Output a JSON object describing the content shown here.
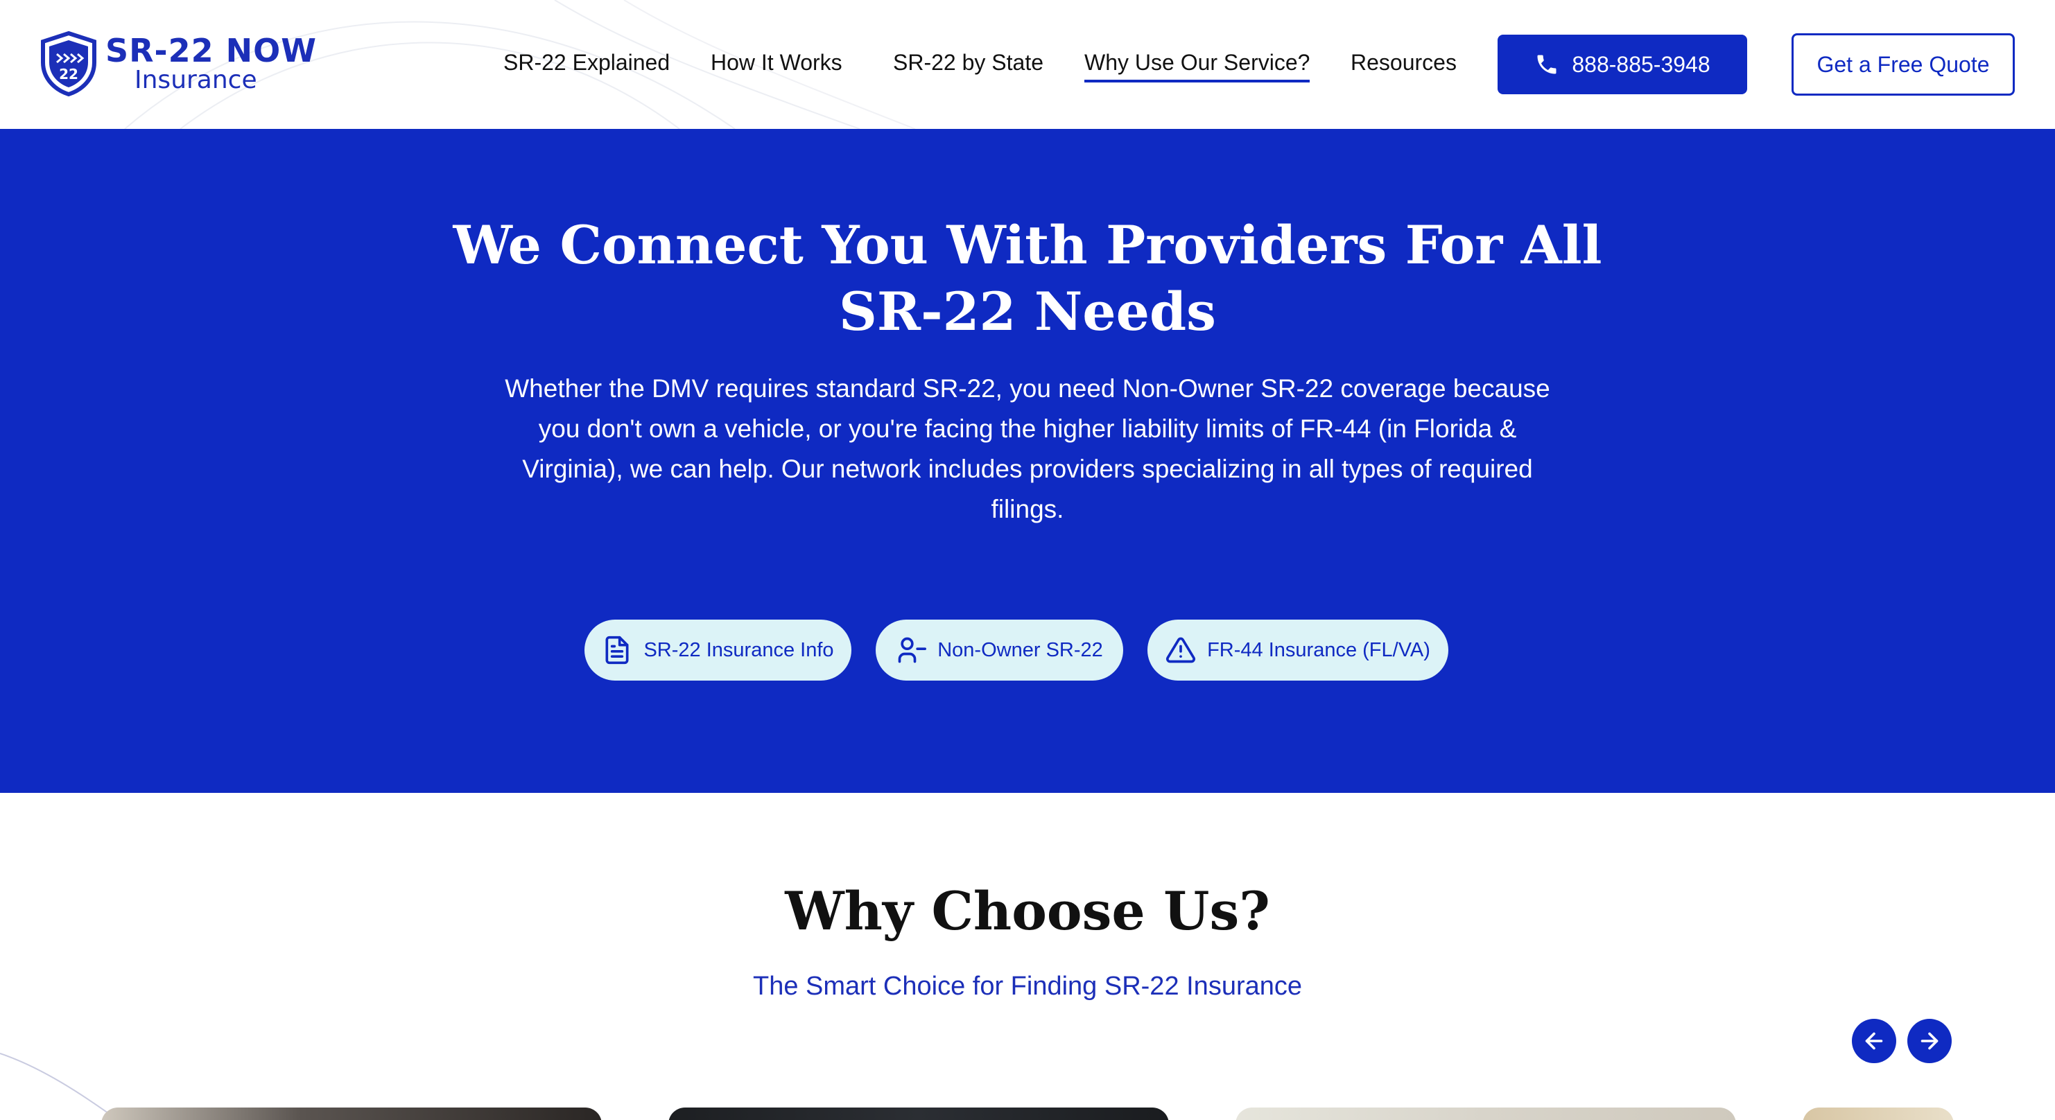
{
  "header": {
    "logo": {
      "main": "SR-22 NOW",
      "sub": "Insurance",
      "badge": "22"
    },
    "nav": [
      {
        "label": "SR-22 Explained",
        "active": false
      },
      {
        "label": "How It Works",
        "active": false
      },
      {
        "label": "SR-22 by State",
        "active": false
      },
      {
        "label": "Why Use Our Service?",
        "active": true
      },
      {
        "label": "Resources",
        "active": false
      }
    ],
    "phone": "888-885-3948",
    "quote_label": "Get a Free Quote"
  },
  "hero": {
    "title_line1": "We Connect You With Providers For All",
    "title_line2": "SR-22 Needs",
    "description": "Whether the DMV requires standard SR-22, you need Non-Owner SR-22 coverage because you don't own a vehicle, or you're facing the higher liability limits of FR-44 (in Florida & Virginia), we can help. Our network includes providers specializing in all types of required filings.",
    "pills": [
      {
        "label": "SR-22 Insurance Info",
        "icon": "document-icon"
      },
      {
        "label": "Non-Owner SR-22",
        "icon": "user-minus-icon"
      },
      {
        "label": "FR-44 Insurance (FL/VA)",
        "icon": "warning-triangle-icon"
      }
    ]
  },
  "why": {
    "title": "Why Choose Us?",
    "subtitle": "The Smart Choice for Finding SR-22 Insurance"
  },
  "colors": {
    "brand_blue": "#0f2ac2",
    "pill_bg": "#dcf3f7",
    "logo_blue": "#1c2fb8"
  }
}
